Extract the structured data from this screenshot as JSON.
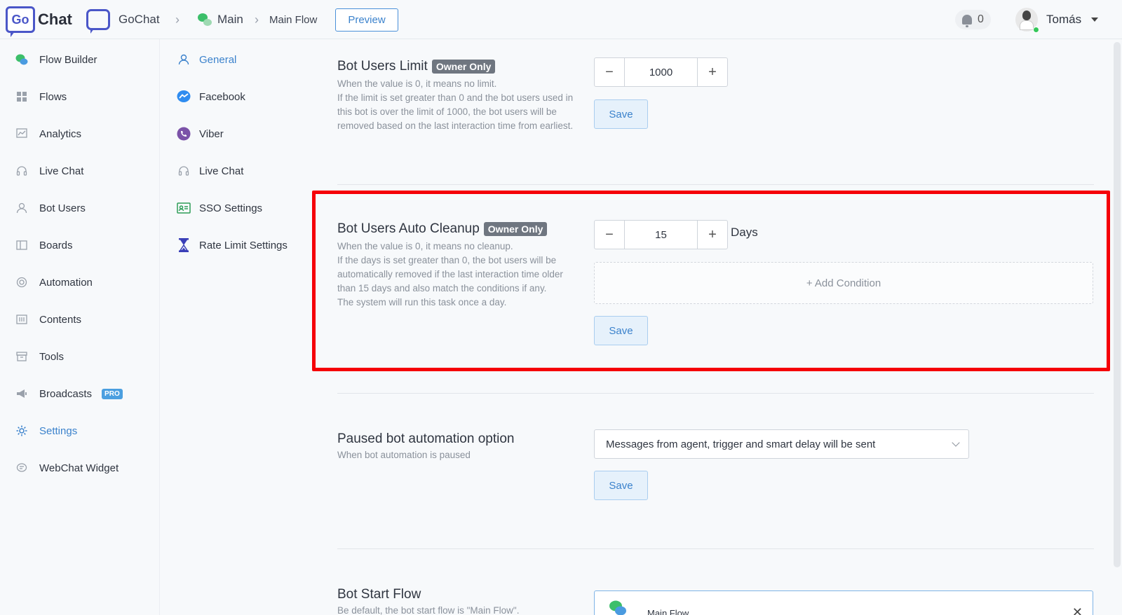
{
  "header": {
    "logo_go": "Go",
    "logo_chat": "Chat",
    "breadcrumb_workspace": "GoChat",
    "breadcrumb_bot": "Main",
    "breadcrumb_flow": "Main Flow",
    "preview_label": "Preview",
    "notification_count": "0",
    "user_name": "Tomás"
  },
  "sidebar": {
    "items": [
      {
        "label": "Flow Builder",
        "icon": "flow-builder-icon"
      },
      {
        "label": "Flows",
        "icon": "grid-icon"
      },
      {
        "label": "Analytics",
        "icon": "chart-icon"
      },
      {
        "label": "Live Chat",
        "icon": "headset-icon"
      },
      {
        "label": "Bot Users",
        "icon": "user-icon"
      },
      {
        "label": "Boards",
        "icon": "board-icon"
      },
      {
        "label": "Automation",
        "icon": "automation-icon"
      },
      {
        "label": "Contents",
        "icon": "contents-icon"
      },
      {
        "label": "Tools",
        "icon": "tools-icon"
      },
      {
        "label": "Broadcasts",
        "icon": "megaphone-icon",
        "badge": "PRO"
      },
      {
        "label": "Settings",
        "icon": "gear-icon",
        "active": true
      },
      {
        "label": "WebChat Widget",
        "icon": "chat-bubble-icon"
      }
    ]
  },
  "subnav": {
    "items": [
      {
        "label": "General",
        "icon": "user-icon",
        "active": true
      },
      {
        "label": "Facebook",
        "icon": "messenger-icon"
      },
      {
        "label": "Viber",
        "icon": "viber-icon"
      },
      {
        "label": "Live Chat",
        "icon": "headset-icon"
      },
      {
        "label": "SSO Settings",
        "icon": "id-card-icon"
      },
      {
        "label": "Rate Limit Settings",
        "icon": "hourglass-icon"
      }
    ]
  },
  "bot_users_limit": {
    "title": "Bot Users Limit",
    "badge": "Owner Only",
    "desc_line1": "When the value is 0, it means no limit.",
    "desc_line2": "If the limit is set greater than 0 and the bot users used in this bot is over the limit of 1000, the bot users will be removed based on the last interaction time from earliest.",
    "value": "1000",
    "save_label": "Save"
  },
  "auto_cleanup": {
    "title": "Bot Users Auto Cleanup",
    "badge": "Owner Only",
    "desc_line1": "When the value is 0, it means no cleanup.",
    "desc_line2": "If the days is set greater than 0, the bot users will be automatically removed if the last interaction time older than 15 days and also match the conditions if any.",
    "desc_line3": "The system will run this task once a day.",
    "value": "15",
    "unit": "Days",
    "add_condition_label": "+ Add Condition",
    "save_label": "Save"
  },
  "paused_automation": {
    "title": "Paused bot automation option",
    "desc": "When bot automation is paused",
    "selected_option": "Messages from agent, trigger and smart delay will be sent",
    "save_label": "Save"
  },
  "bot_start_flow": {
    "title": "Bot Start Flow",
    "desc": "Be default, the bot start flow is \"Main Flow\".",
    "selected_flow": "Main Flow"
  },
  "colors": {
    "accent": "#3b82cc",
    "highlight": "#f50008",
    "brand": "#4a56c8"
  }
}
